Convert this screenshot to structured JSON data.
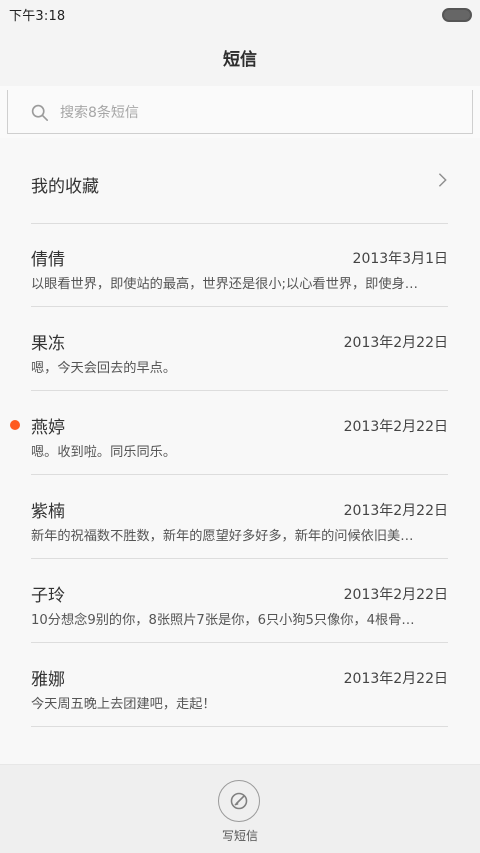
{
  "status_bar": {
    "time": "下午3:18"
  },
  "header": {
    "title": "短信"
  },
  "search": {
    "placeholder": "搜索8条短信"
  },
  "favorites": {
    "label": "我的收藏"
  },
  "threads": [
    {
      "contact": "倩倩",
      "date": "2013年3月1日",
      "preview": "以眼看世界，即使站的最高，世界还是很小;以心看世界，即使身…",
      "unread": false
    },
    {
      "contact": "果冻",
      "date": "2013年2月22日",
      "preview": "嗯，今天会回去的早点。",
      "unread": false
    },
    {
      "contact": "燕婷",
      "date": "2013年2月22日",
      "preview": "嗯。收到啦。同乐同乐。",
      "unread": true
    },
    {
      "contact": "紫楠",
      "date": "2013年2月22日",
      "preview": "新年的祝福数不胜数，新年的愿望好多好多，新年的问候依旧美…",
      "unread": false
    },
    {
      "contact": "子玲",
      "date": "2013年2月22日",
      "preview": "10分想念9别的你，8张照片7张是你，6只小狗5只像你，4根骨…",
      "unread": false
    },
    {
      "contact": "雅娜",
      "date": "2013年2月22日",
      "preview": "今天周五晚上去团建吧，走起！",
      "unread": false
    }
  ],
  "bottom_bar": {
    "compose_label": "写短信",
    "compose_icon": "compose-icon"
  },
  "colors": {
    "unread_dot": "#ff5a1f",
    "background": "#f8f8f8",
    "divider": "#dddddd"
  }
}
